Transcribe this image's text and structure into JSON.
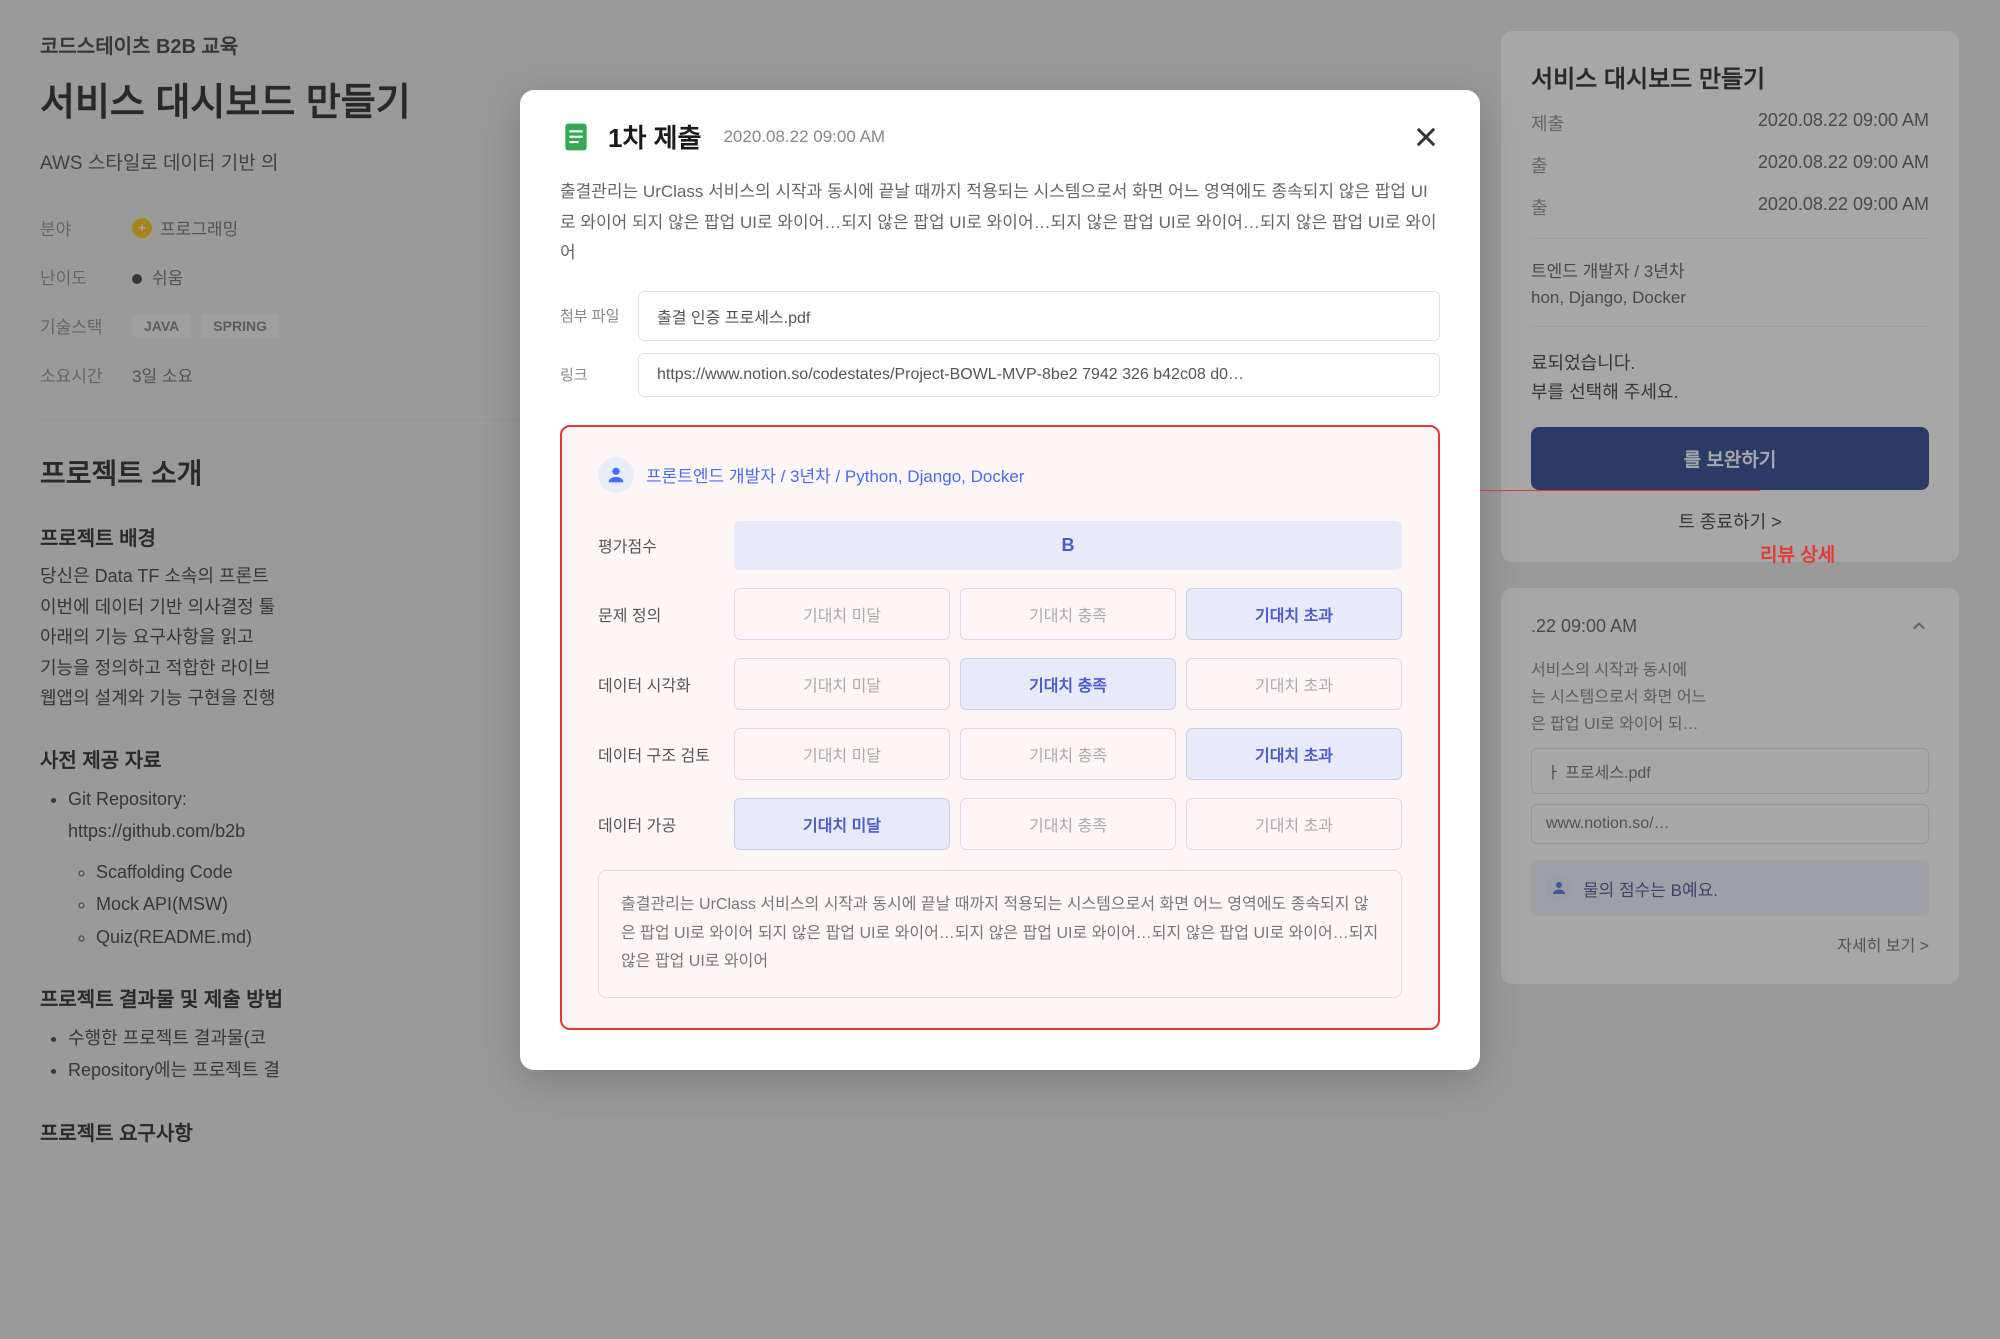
{
  "breadcrumb": "코드스테이츠 B2B 교육",
  "page_title": "서비스 대시보드 만들기",
  "page_subtitle": "AWS 스타일로 데이터 기반 의",
  "meta": {
    "field_label": "분야",
    "field_value": "프로그래밍",
    "difficulty_label": "난이도",
    "difficulty_value": "쉬움",
    "tech_label": "기술스택",
    "tech_tags": [
      "JAVA",
      "SPRING"
    ],
    "time_label": "소요시간",
    "time_value": "3일 소요"
  },
  "intro": {
    "title": "프로젝트 소개",
    "bg_title": "프로젝트 배경",
    "bg_lines": [
      "당신은 Data TF 소속의 프론트",
      "이번에 데이터 기반 의사결정 툴",
      "아래의 기능 요구사항을 읽고",
      "기능을 정의하고 적합한 라이브",
      "웹앱의 설계와 기능 구현을 진행"
    ],
    "materials_title": "사전 제공 자료",
    "materials": {
      "repo_label": "Git Repository:",
      "repo_url": "https://github.com/b2b",
      "items": [
        "Scaffolding Code",
        "Mock API(MSW)",
        "Quiz(README.md)"
      ]
    },
    "results_title": "프로젝트 결과물 및 제출 방법",
    "results": [
      "수행한 프로젝트 결과물(코",
      "Repository에는 프로젝트 결"
    ],
    "req_title": "프로젝트 요구사항"
  },
  "sidebar_card": {
    "title": "서비스 대시보드 만들기",
    "rows": [
      {
        "label": "제출",
        "value": "2020.08.22 09:00 AM"
      },
      {
        "label": "출",
        "value": "2020.08.22 09:00 AM"
      },
      {
        "label": "출",
        "value": "2020.08.22 09:00 AM"
      }
    ],
    "reviewer_role": "트엔드 개발자",
    "reviewer_years": "/ 3년차",
    "reviewer_skills": "hon, Django, Docker",
    "status_line1": "료되었습니다.",
    "status_line2": "부를 선택해 주세요.",
    "primary_btn": "를 보완하기",
    "end_link": "트 종료하기 >"
  },
  "submission_card": {
    "date": ".22 09:00 AM",
    "desc": "서비스의 시작과 동시에\n는 시스템으로서 화면 어느\n은 팝업 UI로 와이어 되…",
    "attachment": "ㅏ 프로세스.pdf",
    "link": "www.notion.so/…",
    "score_text": "물의 점수는 B예요.",
    "detail": "자세히 보기 >"
  },
  "modal": {
    "title": "1차 제출",
    "date": "2020.08.22 09:00 AM",
    "description": "출결관리는 UrClass 서비스의 시작과 동시에 끝날 때까지 적용되는 시스템으로서 화면 어느 영역에도 종속되지 않은 팝업 UI로 와이어 되지 않은 팝업 UI로 와이어…되지 않은 팝업 UI로 와이어…되지 않은 팝업 UI로 와이어…되지 않은 팝업 UI로 와이어",
    "attach_label": "첨부 파일",
    "attach_value": "출결 인증 프로세스.pdf",
    "link_label": "링크",
    "link_value": "https://www.notion.so/codestates/Project-BOWL-MVP-8be2 7942 326 b42c08 d0…",
    "review": {
      "reviewer": "프론트엔드 개발자  / 3년차  / Python, Django, Docker",
      "score_label": "평가점수",
      "score_value": "B",
      "options": {
        "below": "기대치 미달",
        "meet": "기대치 충족",
        "exceed": "기대치 초과"
      },
      "criteria": [
        {
          "label": "문제 정의",
          "selected": "exceed"
        },
        {
          "label": "데이터 시각화",
          "selected": "meet"
        },
        {
          "label": "데이터 구조 검토",
          "selected": "exceed"
        },
        {
          "label": "데이터 가공",
          "selected": "below"
        }
      ],
      "comment": "출결관리는 UrClass 서비스의 시작과 동시에 끝날 때까지 적용되는 시스템으로서 화면 어느 영역에도 종속되지 않은 팝업 UI로 와이어 되지 않은 팝업 UI로 와이어…되지 않은 팝업 UI로 와이어…되지 않은 팝업 UI로 와이어…되지 않은 팝업 UI로 와이어"
    }
  },
  "annotation": {
    "label": "리뷰 상세"
  }
}
